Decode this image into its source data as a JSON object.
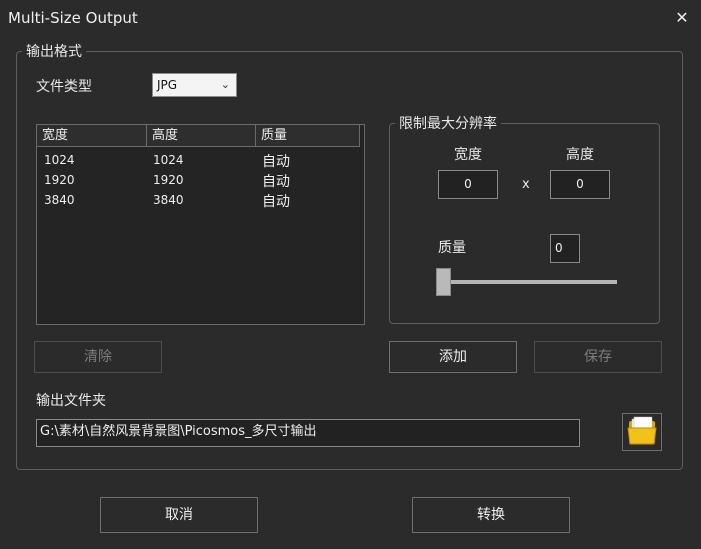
{
  "window": {
    "title": "Multi-Size Output",
    "close_glyph": "✕"
  },
  "format_group": {
    "legend": "输出格式",
    "file_type_label": "文件类型",
    "file_type_value": "JPG",
    "table": {
      "headers": [
        "宽度",
        "高度",
        "质量"
      ],
      "rows": [
        [
          "1024",
          "1024",
          "自动"
        ],
        [
          "1920",
          "1920",
          "自动"
        ],
        [
          "3840",
          "3840",
          "自动"
        ]
      ]
    },
    "clear_button": "清除",
    "limit_group": {
      "legend": "限制最大分辨率",
      "width_label": "宽度",
      "height_label": "高度",
      "width_value": "0",
      "height_value": "0",
      "x_sep": "x",
      "quality_label": "质量",
      "quality_value": "0",
      "quality_slider_fraction": 0
    },
    "add_button": "添加",
    "save_button": "保存",
    "output_folder_label": "输出文件夹",
    "output_folder_path": "G:\\素材\\自然风景背景图\\Picosmos_多尺寸输出",
    "folder_icon": "folder-icon"
  },
  "footer": {
    "cancel_button": "取消",
    "convert_button": "转换"
  }
}
